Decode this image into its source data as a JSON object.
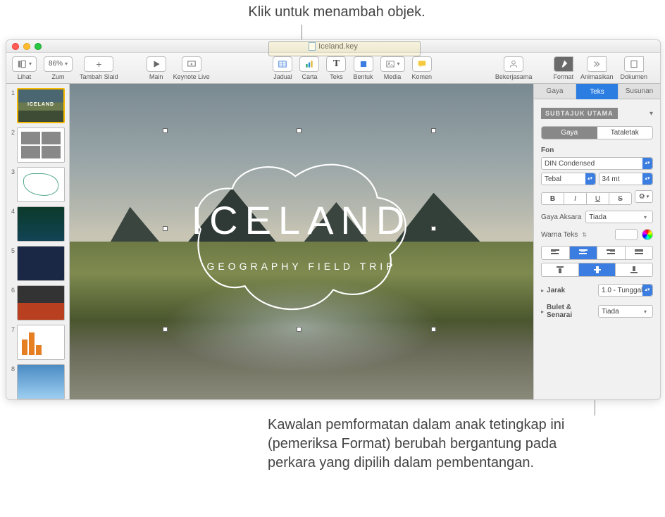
{
  "annotations": {
    "top": "Klik untuk menambah objek.",
    "bottom": "Kawalan pemformatan dalam anak tetingkap ini (pemeriksa Format) berubah bergantung pada perkara yang dipilih dalam pembentangan."
  },
  "window": {
    "title": "Iceland.key"
  },
  "toolbar": {
    "view": "Lihat",
    "zoom_label": "Zum",
    "zoom_value": "86%",
    "add_slide": "Tambah Slaid",
    "play": "Main",
    "keynote_live": "Keynote Live",
    "table": "Jadual",
    "chart": "Carta",
    "text": "Teks",
    "shape": "Bentuk",
    "media": "Media",
    "comment": "Komen",
    "collaborate": "Bekerjasama",
    "format": "Format",
    "animate": "Animasikan",
    "document": "Dokumen"
  },
  "navigator": {
    "slides": [
      "1",
      "2",
      "3",
      "4",
      "5",
      "6",
      "7",
      "8"
    ],
    "thumb1_title": "ICELAND"
  },
  "slide": {
    "title": "ICELAND",
    "subtitle": "GEOGRAPHY FIELD TRIP"
  },
  "inspector": {
    "tabs": {
      "style": "Gaya",
      "text": "Teks",
      "arrange": "Susunan"
    },
    "paragraph_style": "SUBTAJUK UTAMA",
    "subtabs": {
      "style": "Gaya",
      "layout": "Tataletak"
    },
    "font_section": "Fon",
    "font_family": "DIN Condensed",
    "font_weight": "Tebal",
    "font_size": "34 mt",
    "char_style_label": "Gaya Aksara",
    "char_style_value": "Tiada",
    "text_color_label": "Warna Teks",
    "spacing_label": "Jarak",
    "spacing_value": "1.0 - Tunggal",
    "bullets_label": "Bulet & Senarai",
    "bullets_value": "Tiada",
    "bold": "B",
    "italic": "I",
    "underline": "U",
    "strike": "S"
  }
}
